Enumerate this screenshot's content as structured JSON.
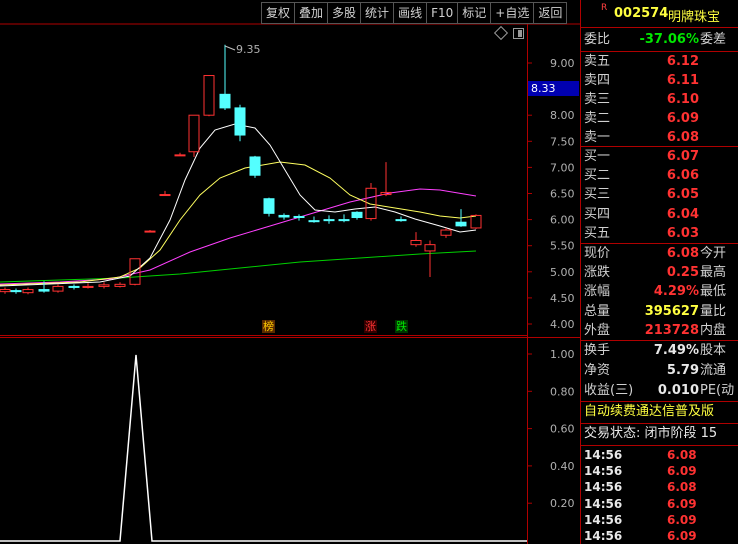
{
  "toolbar": {
    "items": [
      "复权",
      "叠加",
      "多股",
      "统计",
      "画线",
      "F10",
      "标记",
      "+自选",
      "返回"
    ]
  },
  "stock": {
    "badge": "R",
    "code": "002574",
    "name": "明牌珠宝"
  },
  "price_axis": [
    "9.00",
    "8.50",
    "8.00",
    "7.50",
    "7.00",
    "6.50",
    "6.00",
    "5.50",
    "5.00",
    "4.50",
    "4.00"
  ],
  "current_price_tag": "8.33",
  "high_label": "9.35",
  "event_markers": [
    "榜",
    "涨",
    "跌"
  ],
  "indicator_axis": [
    "1.00",
    "0.80",
    "0.60",
    "0.40",
    "0.20"
  ],
  "quote": {
    "wei_bi": {
      "label": "委比",
      "value": "-37.06%",
      "label2": "委差"
    },
    "sell": [
      {
        "label": "卖五",
        "price": "6.12"
      },
      {
        "label": "卖四",
        "price": "6.11"
      },
      {
        "label": "卖三",
        "price": "6.10"
      },
      {
        "label": "卖二",
        "price": "6.09"
      },
      {
        "label": "卖一",
        "price": "6.08"
      }
    ],
    "buy": [
      {
        "label": "买一",
        "price": "6.07"
      },
      {
        "label": "买二",
        "price": "6.06"
      },
      {
        "label": "买三",
        "price": "6.05"
      },
      {
        "label": "买四",
        "price": "6.04"
      },
      {
        "label": "买五",
        "price": "6.03"
      }
    ],
    "stats": [
      {
        "label": "现价",
        "value": "6.08",
        "label2": "今开",
        "color": "red"
      },
      {
        "label": "涨跌",
        "value": "0.25",
        "label2": "最高",
        "color": "red"
      },
      {
        "label": "涨幅",
        "value": "4.29%",
        "label2": "最低",
        "color": "red"
      },
      {
        "label": "总量",
        "value": "395627",
        "label2": "量比",
        "color": "yellow"
      },
      {
        "label": "外盘",
        "value": "213728",
        "label2": "内盘",
        "color": "red"
      }
    ],
    "fundamentals": [
      {
        "label": "换手",
        "value": "7.49%",
        "label2": "股本"
      },
      {
        "label": "净资",
        "value": "5.79",
        "label2": "流通"
      },
      {
        "label": "收益(三)",
        "value": "0.010",
        "label2": "PE(动"
      }
    ],
    "notice": "自动续费通达信普及版",
    "status": "交易状态: 闭市阶段 15",
    "ticks": [
      {
        "time": "14:56",
        "price": "6.08"
      },
      {
        "time": "14:56",
        "price": "6.09"
      },
      {
        "time": "14:56",
        "price": "6.08"
      },
      {
        "time": "14:56",
        "price": "6.09"
      },
      {
        "time": "14:56",
        "price": "6.09"
      },
      {
        "time": "14:56",
        "price": "6.09"
      }
    ]
  },
  "colors": {
    "up": "#ff3232",
    "down": "#54ffff",
    "ma5": "#ffffff",
    "ma10": "#ffff60",
    "ma20": "#ff40ff",
    "ma60": "#00d000",
    "border": "#b00000"
  }
}
